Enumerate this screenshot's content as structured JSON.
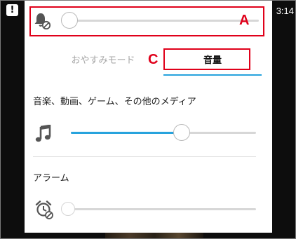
{
  "status_bar": {
    "alert_glyph": "!",
    "time": "3:14"
  },
  "ringer_row": {
    "icon": "bell-mute-icon",
    "level": 0
  },
  "tabs": [
    {
      "label": "おやすみモード",
      "active": false
    },
    {
      "label": "音量",
      "active": true
    }
  ],
  "media": {
    "label": "音楽、動画、ゲーム、その他のメディア",
    "icon": "music-note-icon",
    "level": 0.6
  },
  "alarm": {
    "label": "アラーム",
    "icon": "alarm-mute-icon",
    "level": 0
  },
  "annotations": {
    "a_label": "A",
    "c_label": "C"
  },
  "colors": {
    "accent": "#27a3dd",
    "annotation": "#e0001a",
    "panel": "#ffffff",
    "background": "#0d0d0d"
  }
}
